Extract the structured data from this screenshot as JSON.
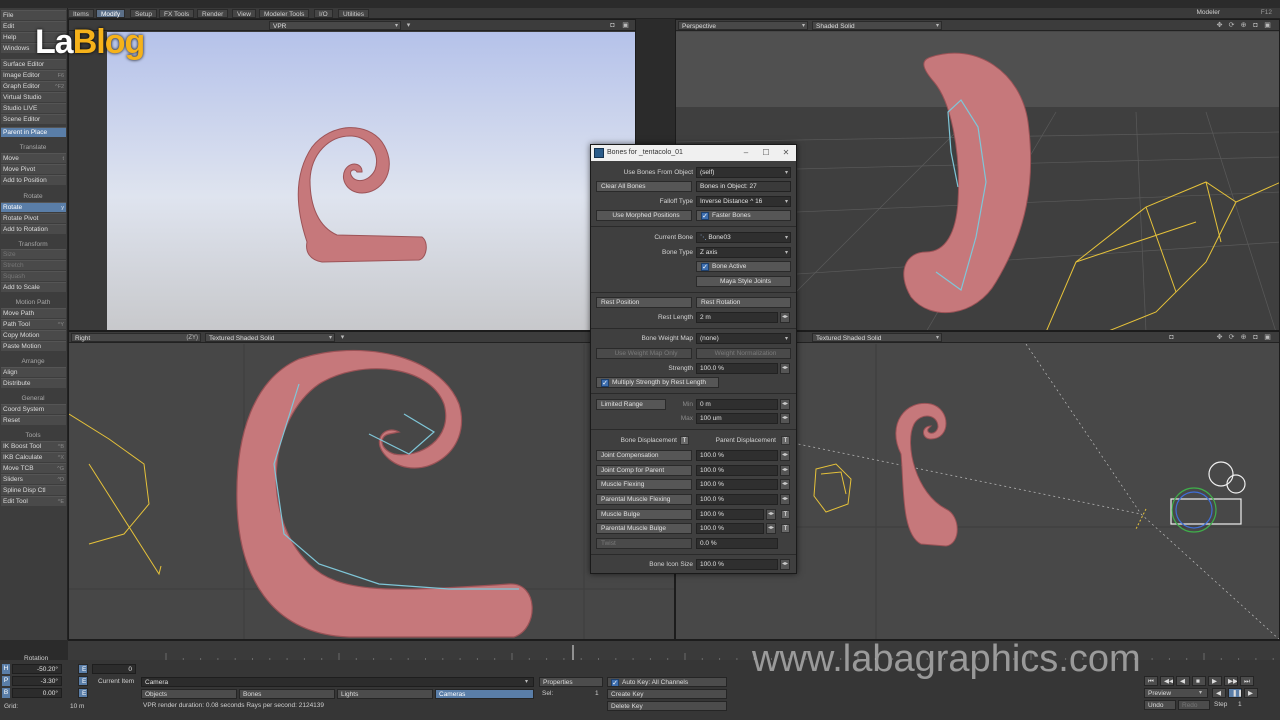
{
  "top_menu": {
    "tabs": [
      "Items",
      "Modify",
      "Setup",
      "FX Tools",
      "Render",
      "View",
      "Modeler Tools",
      "I/O",
      "Utilities"
    ],
    "active_tab": "Modify",
    "modeler_label": "Modeler",
    "modeler_key": "F12"
  },
  "logo": {
    "part1": "La",
    "part2": "Blog"
  },
  "toolbar": {
    "menus": [
      {
        "label": "File",
        "key": ""
      },
      {
        "label": "Edit",
        "key": ""
      },
      {
        "label": "Help",
        "key": ""
      },
      {
        "label": "Windows",
        "key": ""
      }
    ],
    "editors": [
      {
        "label": "Surface Editor",
        "key": ""
      },
      {
        "label": "Image Editor",
        "key": "F6"
      },
      {
        "label": "Graph Editor",
        "key": "^F2"
      },
      {
        "label": "Virtual Studio",
        "key": ""
      },
      {
        "label": "Studio LIVE",
        "key": ""
      },
      {
        "label": "Scene Editor",
        "key": ""
      }
    ],
    "parent_in_place": "Parent in Place",
    "translate_head": "Translate",
    "translate": [
      {
        "label": "Move",
        "key": "t"
      },
      {
        "label": "Move Pivot",
        "key": ""
      },
      {
        "label": "Add to Position",
        "key": ""
      }
    ],
    "rotate_head": "Rotate",
    "rotate": [
      {
        "label": "Rotate",
        "key": "y"
      },
      {
        "label": "Rotate Pivot",
        "key": ""
      },
      {
        "label": "Add to Rotation",
        "key": ""
      }
    ],
    "transform_head": "Transform",
    "transform": [
      {
        "label": "Size",
        "key": ""
      },
      {
        "label": "Stretch",
        "key": ""
      },
      {
        "label": "Squash",
        "key": ""
      },
      {
        "label": "Add to Scale",
        "key": ""
      }
    ],
    "motion_head": "Motion Path",
    "motion": [
      {
        "label": "Move Path",
        "key": ""
      },
      {
        "label": "Path Tool",
        "key": "^Y"
      },
      {
        "label": "Copy Motion",
        "key": ""
      },
      {
        "label": "Paste Motion",
        "key": ""
      }
    ],
    "arrange_head": "Arrange",
    "arrange": [
      {
        "label": "Align",
        "key": ""
      },
      {
        "label": "Distribute",
        "key": ""
      }
    ],
    "general_head": "General",
    "general": [
      {
        "label": "Coord System",
        "key": ""
      },
      {
        "label": "Reset",
        "key": ""
      }
    ],
    "tools_head": "Tools",
    "tools": [
      {
        "label": "IK Boost Tool",
        "key": "^B"
      },
      {
        "label": "IKB Calculate",
        "key": "^X"
      },
      {
        "label": "Move TCB",
        "key": "^G"
      },
      {
        "label": "Sliders",
        "key": "^D"
      },
      {
        "label": "Spline Disp Ctl",
        "key": ""
      },
      {
        "label": "Edit Tool",
        "key": "^E"
      }
    ]
  },
  "viewports": {
    "tl": {
      "view": "VPR"
    },
    "tr": {
      "view": "Perspective",
      "shading": "Shaded Solid"
    },
    "bl": {
      "view": "Right",
      "axis": "(ZY)",
      "shading": "Textured Shaded Solid"
    },
    "br": {
      "shading": "Textured Shaded Solid"
    }
  },
  "bones_panel": {
    "title": "Bones for _tentacolo_01",
    "use_bones_from_object_label": "Use Bones From Object",
    "use_bones_from_object": "(self)",
    "clear_all_bones": "Clear All Bones",
    "bones_in_object": "Bones in Object: 27",
    "falloff_type_label": "Falloff Type",
    "falloff_type": "Inverse Distance ^ 16",
    "use_morphed_positions": "Use Morphed Positions",
    "faster_bones": "Faster Bones",
    "current_bone_label": "Current Bone",
    "current_bone": "Bone03",
    "bone_type_label": "Bone Type",
    "bone_type": "Z axis",
    "bone_active": "Bone Active",
    "maya_style_joints": "Maya Style Joints",
    "rest_position": "Rest Position",
    "rest_rotation": "Rest Rotation",
    "rest_length_label": "Rest Length",
    "rest_length": "2 m",
    "bone_weight_map_label": "Bone Weight Map",
    "bone_weight_map": "(none)",
    "use_weight_map_only": "Use Weight Map Only",
    "weight_normalization": "Weight Normalization",
    "strength_label": "Strength",
    "strength": "100.0 %",
    "multiply_strength": "Multiply Strength by Rest Length",
    "limited_range": "Limited Range",
    "min_label": "Min",
    "min_value": "0 m",
    "max_label": "Max",
    "max_value": "100 um",
    "bone_displacement": "Bone Displacement",
    "parent_displacement": "Parent Displacement",
    "t_label": "T",
    "e_label": "E",
    "dial_rows": [
      {
        "label": "Joint Compensation",
        "value": "100.0 %",
        "disabled": false
      },
      {
        "label": "Joint Comp for Parent",
        "value": "100.0 %",
        "disabled": false
      },
      {
        "label": "Muscle Flexing",
        "value": "100.0 %",
        "disabled": false
      },
      {
        "label": "Parental Muscle Flexing",
        "value": "100.0 %",
        "disabled": false
      },
      {
        "label": "Muscle Bulge",
        "value": "100.0 %",
        "disabled": false
      },
      {
        "label": "Parental Muscle Bulge",
        "value": "100.0 %",
        "disabled": false
      },
      {
        "label": "Twist",
        "value": "0.0 %",
        "disabled": true
      }
    ],
    "bone_icon_size_label": "Bone Icon Size",
    "bone_icon_size": "100.0 %"
  },
  "timeline": {
    "ticks": [
      "0",
      "10",
      "20",
      "25",
      "30",
      "40",
      "50",
      "60"
    ],
    "current_frame": "25"
  },
  "bottom": {
    "rotation_label": "Rotation",
    "h_label": "H",
    "h_value": "-50.20°",
    "p_label": "P",
    "p_value": "-3.30°",
    "b_label": "B",
    "b_value": "0.00°",
    "grid_label": "Grid:",
    "grid_value": "10 m",
    "frame_value": "0",
    "current_item_label": "Current Item",
    "current_item": "Camera",
    "objects": "Objects",
    "bones": "Bones",
    "lights": "Lights",
    "cameras": "Cameras",
    "status": "VPR render duration: 0.08 seconds  Rays per second: 2124139",
    "properties": "Properties",
    "sel_label": "Sel:",
    "sel_value": "1",
    "auto_key": "Auto Key: All Channels",
    "create_key": "Create Key",
    "delete_key": "Delete Key",
    "preview": "Preview",
    "undo": "Undo",
    "redo": "Redo",
    "step_label": "Step",
    "step_value": "1"
  },
  "watermark": "www.labagraphics.com",
  "colors": {
    "accent": "#5a7ea8",
    "mesh": "#c9777a",
    "bone": "#7fc6d8",
    "camera": "#e6c23a"
  }
}
